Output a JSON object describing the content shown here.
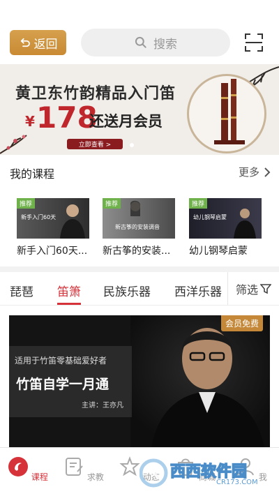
{
  "header": {
    "back_label": "返回",
    "search_placeholder": "搜索"
  },
  "banner": {
    "title": "黄卫东竹韵精品入门笛",
    "currency": "¥",
    "price": "178",
    "subtitle": "还送月会员",
    "cta": "立即查看 >"
  },
  "my_courses": {
    "title": "我的课程",
    "more": "更多",
    "items": [
      {
        "tag": "推荐",
        "name": "新手入门60天...",
        "thumb_text": "新手入门60天"
      },
      {
        "tag": "推荐",
        "name": "新古筝的安装...",
        "thumb_text": "新古筝的安装调音"
      },
      {
        "tag": "推荐",
        "name": "幼儿钢琴启蒙",
        "thumb_text": "幼儿钢琴启蒙"
      }
    ]
  },
  "tabs": {
    "items": [
      "琵琶",
      "笛箫",
      "民族乐器",
      "西洋乐器"
    ],
    "active_index": 1,
    "filter": "筛选"
  },
  "featured": {
    "badge": "会员免费",
    "subtitle": "适用于竹笛零基础爱好者",
    "title": "竹笛自学一月通",
    "teacher": "主讲：王亦凡"
  },
  "bottom_nav": {
    "items": [
      {
        "label": "课程",
        "icon": "course-icon"
      },
      {
        "label": "求教",
        "icon": "ask-icon"
      },
      {
        "label": "动态",
        "icon": "feed-icon"
      },
      {
        "label": "商城",
        "icon": "shop-icon"
      },
      {
        "label": "我",
        "icon": "profile-icon"
      }
    ],
    "active_index": 0
  },
  "watermark": {
    "brand": "西西软件园",
    "url": "CR173.COM"
  },
  "colors": {
    "accent": "#d6323a",
    "back_button": "#c98a33",
    "tag_green": "#6fb14a",
    "badge_gold": "#c48838"
  }
}
